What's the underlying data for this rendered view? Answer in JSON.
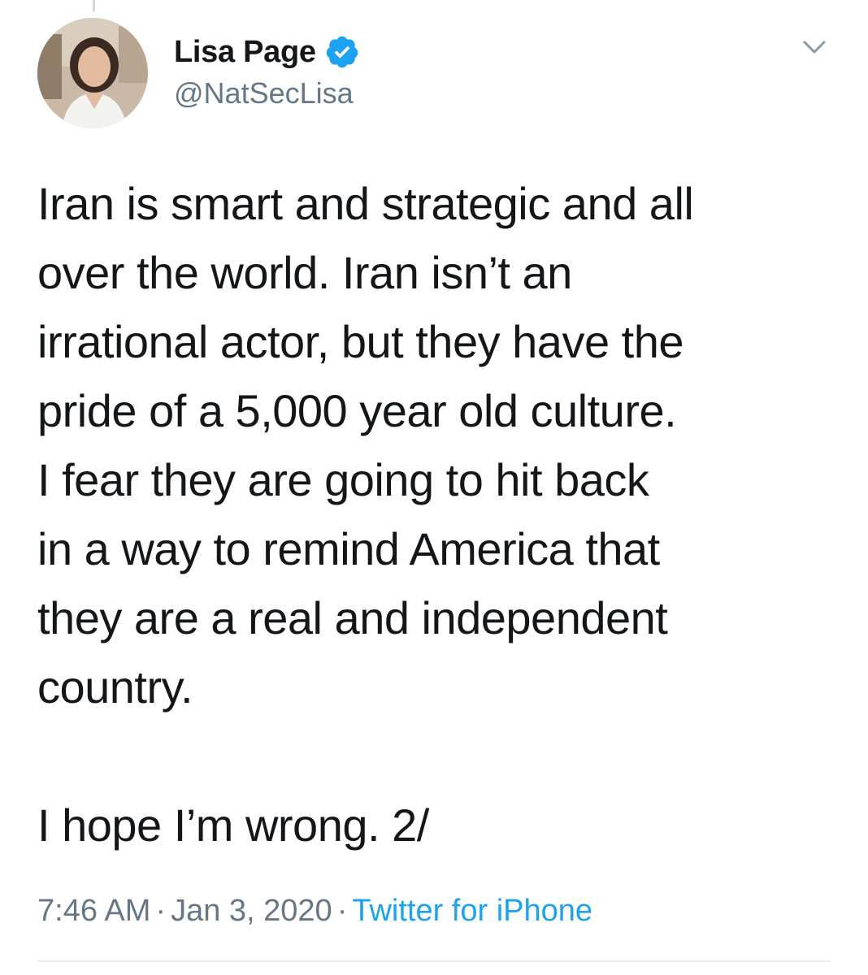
{
  "tweet": {
    "author": {
      "display_name": "Lisa Page",
      "handle": "@NatSecLisa",
      "verified": true,
      "avatar_icon": "profile-photo-avatar"
    },
    "menu_icon": "chevron-down-icon",
    "text_lines": [
      "Iran is smart and strategic and all",
      "over the world. Iran isn’t an",
      "irrational actor, but they have the",
      "pride of a 5,000 year old culture.",
      "I fear they are going to hit back",
      "in a way to remind America that",
      "they are a real and independent",
      "country."
    ],
    "signoff": "I hope I’m wrong. 2/",
    "time": "7:46 AM",
    "separator": "·",
    "date": "Jan 3, 2020",
    "source": "Twitter for iPhone"
  },
  "colors": {
    "text_primary": "#14171a",
    "text_secondary": "#657786",
    "accent": "#1da1f2",
    "divider": "#e6ecf0"
  }
}
